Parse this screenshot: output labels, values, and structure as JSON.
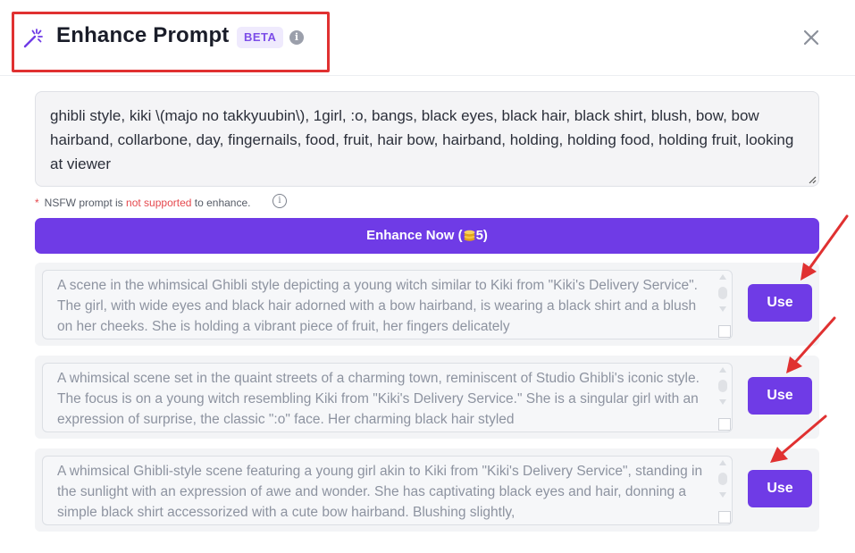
{
  "dialog": {
    "title": "Enhance Prompt",
    "badge": "BETA",
    "info_glyph": "i"
  },
  "prompt": {
    "value": "ghibli style, kiki \\(majo no takkyuubin\\), 1girl, :o, bangs, black eyes, black hair, black shirt, blush, bow, bow hairband, collarbone, day, fingernails, food, fruit, hair bow, hairband, holding, holding food, holding fruit, looking at viewer"
  },
  "notice": {
    "asterisk": "*",
    "before": "NSFW prompt is",
    "highlight": "not supported",
    "after": "to enhance.",
    "info_glyph": "i"
  },
  "enhance_button": {
    "label_before": "Enhance Now (",
    "cost": "5",
    "label_after": ")"
  },
  "results": [
    {
      "text": "A scene in the whimsical Ghibli style depicting a young witch similar to Kiki from \"Kiki's Delivery Service\". The girl, with wide eyes and black hair adorned with a bow hairband, is wearing a black shirt and a blush on her cheeks. She is holding a vibrant piece of fruit, her fingers delicately",
      "button": "Use"
    },
    {
      "text": "A whimsical scene set in the quaint streets of a charming town, reminiscent of Studio Ghibli's iconic style. The focus is on a young witch resembling Kiki from \"Kiki's Delivery Service.\" She is a singular girl with an expression of surprise, the classic \":o\" face. Her charming black hair styled",
      "button": "Use"
    },
    {
      "text": "A whimsical Ghibli-style scene featuring a young girl akin to Kiki from \"Kiki's Delivery Service\", standing in the sunlight with an expression of awe and wonder. She has captivating black eyes and hair, donning a simple black shirt accessorized with a cute bow hairband. Blushing slightly,",
      "button": "Use"
    }
  ],
  "colors": {
    "accent": "#6f3be6",
    "annotation": "#e03131",
    "warning": "#e5484d"
  },
  "icons": {
    "title": "magic-wand-icon",
    "close": "close-icon",
    "cost": "coin-stack-icon"
  }
}
